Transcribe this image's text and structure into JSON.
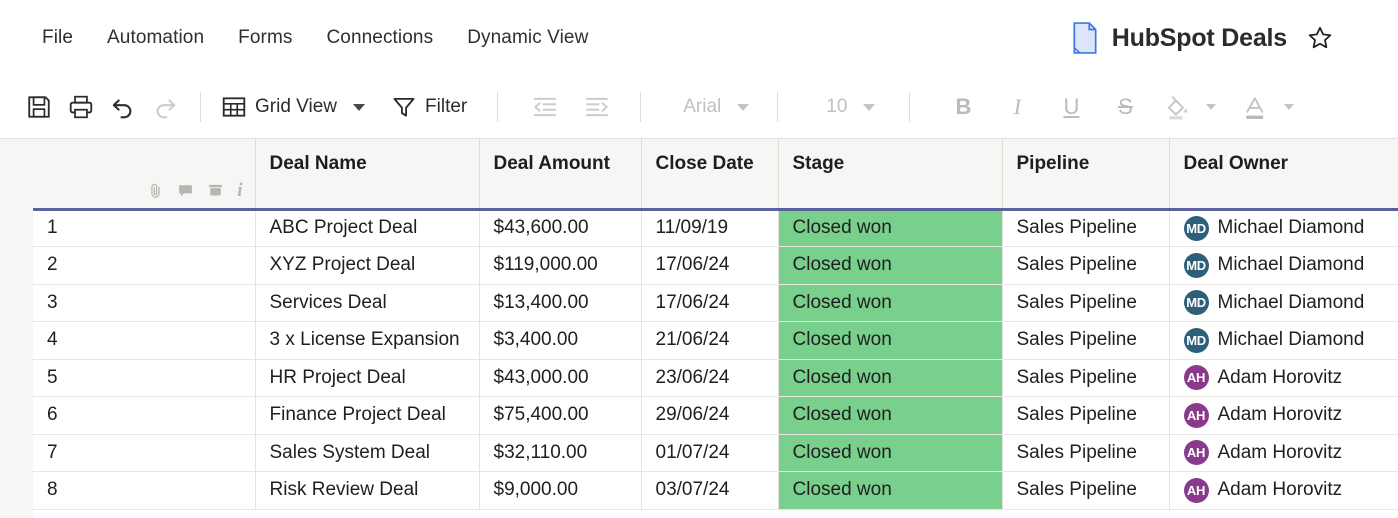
{
  "menu": {
    "items": [
      {
        "label": "File",
        "name": "menu-file"
      },
      {
        "label": "Automation",
        "name": "menu-automation"
      },
      {
        "label": "Forms",
        "name": "menu-forms"
      },
      {
        "label": "Connections",
        "name": "menu-connections"
      },
      {
        "label": "Dynamic View",
        "name": "menu-dynamic-view"
      }
    ]
  },
  "header": {
    "title": "HubSpot Deals",
    "doc_icon": "document-icon",
    "star_icon": "star-outline-icon",
    "doc_icon_color": "#4285f4"
  },
  "toolbar": {
    "save_icon": "save-icon",
    "print_icon": "print-icon",
    "undo_icon": "undo-icon",
    "redo_icon": "redo-icon",
    "grid_icon": "grid-table-icon",
    "view_label": "Grid View",
    "filter_icon": "funnel-filter-icon",
    "filter_label": "Filter",
    "indent_decrease_icon": "indent-decrease-icon",
    "indent_increase_icon": "indent-increase-icon",
    "font_family": "Arial",
    "font_size": "10",
    "bold_label": "B",
    "italic_label": "I",
    "underline_label": "U",
    "strike_label": "S",
    "fill_color_icon": "paint-bucket-icon",
    "text_color_icon": "text-color-icon"
  },
  "grid": {
    "row_header_icons": [
      "attachment-icon",
      "comment-icon",
      "archive-icon",
      "info-icon"
    ],
    "columns": [
      "Deal Name",
      "Deal Amount",
      "Close Date",
      "Stage",
      "Pipeline",
      "Deal Owner"
    ],
    "stage_cell_color": "#79cf8c",
    "header_underline_color": "#59629b",
    "rows": [
      {
        "n": "1",
        "deal_name": "ABC Project Deal",
        "deal_amount": "$43,600.00",
        "close_date": "11/09/19",
        "stage": "Closed won",
        "pipeline": "Sales Pipeline",
        "owner": "Michael Diamond",
        "initials": "MD",
        "avatar_color": "#2d5f7a"
      },
      {
        "n": "2",
        "deal_name": "XYZ Project Deal",
        "deal_amount": "$119,000.00",
        "close_date": "17/06/24",
        "stage": "Closed won",
        "pipeline": "Sales Pipeline",
        "owner": "Michael Diamond",
        "initials": "MD",
        "avatar_color": "#2d5f7a"
      },
      {
        "n": "3",
        "deal_name": "Services Deal",
        "deal_amount": "$13,400.00",
        "close_date": "17/06/24",
        "stage": "Closed won",
        "pipeline": "Sales Pipeline",
        "owner": "Michael Diamond",
        "initials": "MD",
        "avatar_color": "#2d5f7a"
      },
      {
        "n": "4",
        "deal_name": "3 x License Expansion",
        "deal_amount": "$3,400.00",
        "close_date": "21/06/24",
        "stage": "Closed won",
        "pipeline": "Sales Pipeline",
        "owner": "Michael Diamond",
        "initials": "MD",
        "avatar_color": "#2d5f7a"
      },
      {
        "n": "5",
        "deal_name": "HR Project Deal",
        "deal_amount": "$43,000.00",
        "close_date": "23/06/24",
        "stage": "Closed won",
        "pipeline": "Sales Pipeline",
        "owner": "Adam Horovitz",
        "initials": "AH",
        "avatar_color": "#8a3a8a"
      },
      {
        "n": "6",
        "deal_name": "Finance Project Deal",
        "deal_amount": "$75,400.00",
        "close_date": "29/06/24",
        "stage": "Closed won",
        "pipeline": "Sales Pipeline",
        "owner": "Adam Horovitz",
        "initials": "AH",
        "avatar_color": "#8a3a8a"
      },
      {
        "n": "7",
        "deal_name": "Sales System Deal",
        "deal_amount": "$32,110.00",
        "close_date": "01/07/24",
        "stage": "Closed won",
        "pipeline": "Sales Pipeline",
        "owner": "Adam Horovitz",
        "initials": "AH",
        "avatar_color": "#8a3a8a"
      },
      {
        "n": "8",
        "deal_name": "Risk Review Deal",
        "deal_amount": "$9,000.00",
        "close_date": "03/07/24",
        "stage": "Closed won",
        "pipeline": "Sales Pipeline",
        "owner": "Adam Horovitz",
        "initials": "AH",
        "avatar_color": "#8a3a8a"
      }
    ]
  }
}
